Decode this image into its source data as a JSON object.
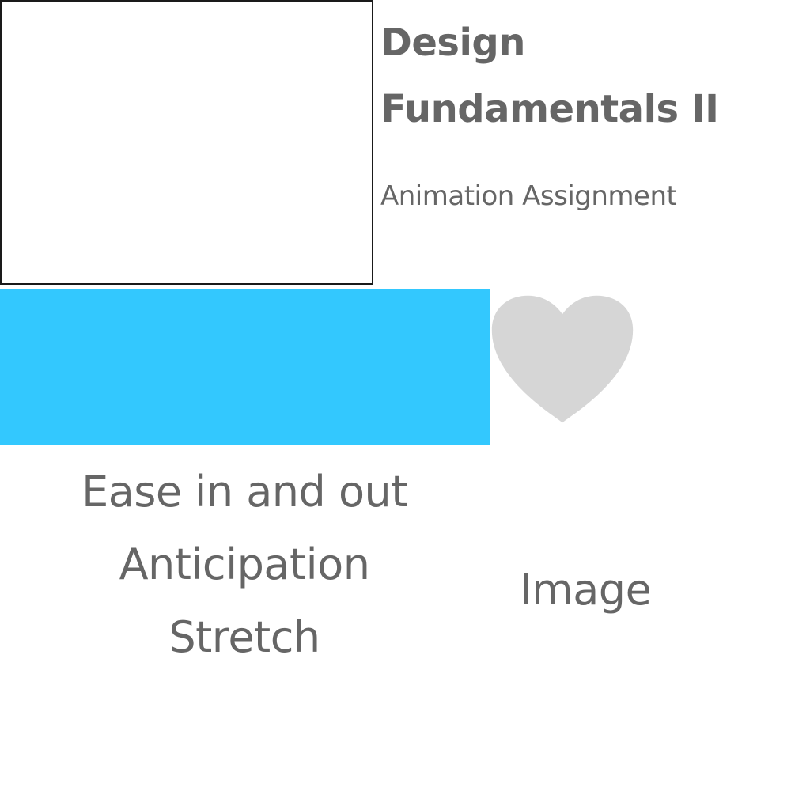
{
  "header": {
    "title": "Design Fundamentals II",
    "subtitle": "Animation Assignment"
  },
  "colors": {
    "bar": "#33C8FE",
    "heart": "#D6D6D6",
    "text": "#666666",
    "frame_border": "#1A1A1A"
  },
  "heart": {
    "icon": "heart-icon"
  },
  "principles": [
    "Ease in and out",
    "Anticipation",
    "Stretch"
  ],
  "image_label": "Image"
}
